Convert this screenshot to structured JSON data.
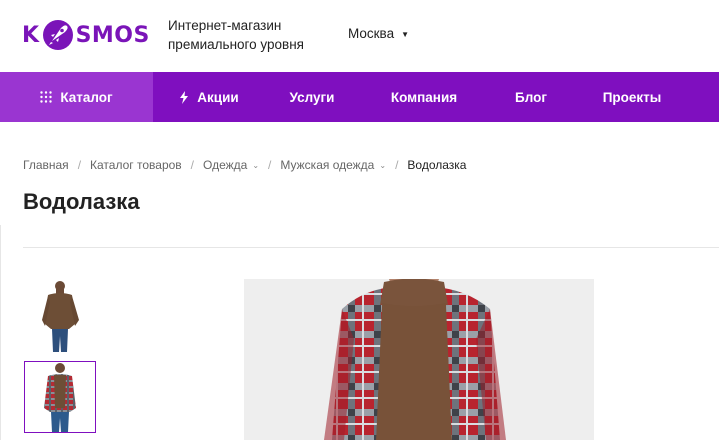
{
  "header": {
    "logo_text": "KOSMOS",
    "tagline_line1": "Интернет-магазин",
    "tagline_line2": "премиального уровня",
    "city": "Москва",
    "brand_color": "#7f0fbf"
  },
  "nav": {
    "items": [
      {
        "label": "Каталог",
        "icon": "grid-icon"
      },
      {
        "label": "Акции",
        "icon": "lightning-icon"
      },
      {
        "label": "Услуги"
      },
      {
        "label": "Компания"
      },
      {
        "label": "Блог"
      },
      {
        "label": "Проекты"
      }
    ]
  },
  "breadcrumb": [
    {
      "label": "Главная"
    },
    {
      "label": "Каталог товаров"
    },
    {
      "label": "Одежда",
      "dropdown": true
    },
    {
      "label": "Мужская одежда",
      "dropdown": true
    },
    {
      "label": "Водолазка",
      "current": true
    }
  ],
  "page": {
    "title": "Водолазка"
  },
  "gallery": {
    "thumbnails": [
      {
        "name": "turtleneck-front"
      },
      {
        "name": "turtleneck-with-plaid-shirt",
        "selected": true
      }
    ],
    "main_image": "turtleneck-with-plaid-shirt"
  }
}
